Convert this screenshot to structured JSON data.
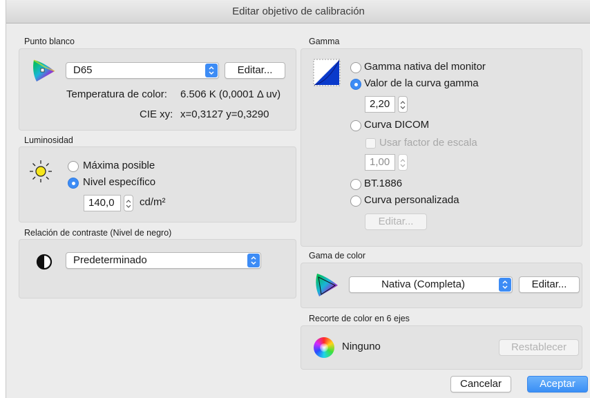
{
  "window": {
    "title": "Editar objetivo de calibración"
  },
  "white_point": {
    "section_label": "Punto blanco",
    "preset_value": "D65",
    "edit_label": "Editar...",
    "temperature_label": "Temperatura de color:",
    "temperature_value": "6.506 K (0,0001 Δ uv)",
    "cie_label": "CIE xy:",
    "cie_value": "x=0,3127 y=0,3290"
  },
  "luminance": {
    "section_label": "Luminosidad",
    "option_max": "Máxima posible",
    "option_specific": "Nivel específico",
    "value": "140,0",
    "unit": "cd/m²",
    "selected": "specific"
  },
  "contrast": {
    "section_label": "Relación de contraste (Nivel de negro)",
    "value": "Predeterminado"
  },
  "gamma": {
    "section_label": "Gamma",
    "options": [
      {
        "label": "Gamma nativa del monitor",
        "selected": false
      },
      {
        "label": "Valor de la curva gamma",
        "selected": true
      },
      {
        "label": "Curva DICOM",
        "selected": false
      },
      {
        "label": "BT.1886",
        "selected": false
      },
      {
        "label": "Curva personalizada",
        "selected": false
      }
    ],
    "curve_value": "2,20",
    "scale_factor_label": "Usar factor de escala",
    "scale_factor_checked": false,
    "scale_factor_value": "1,00",
    "edit_label": "Editar..."
  },
  "gamut": {
    "section_label": "Gama de color",
    "value": "Nativa (Completa)",
    "edit_label": "Editar..."
  },
  "clipping": {
    "section_label": "Recorte de color en 6 ejes",
    "value": "Ninguno",
    "reset_label": "Restablecer"
  },
  "footer": {
    "cancel_label": "Cancelar",
    "accept_label": "Aceptar"
  },
  "colors": {
    "accent": "#3d8cf5",
    "panel": "#e3e3e3",
    "window": "#ececec"
  }
}
